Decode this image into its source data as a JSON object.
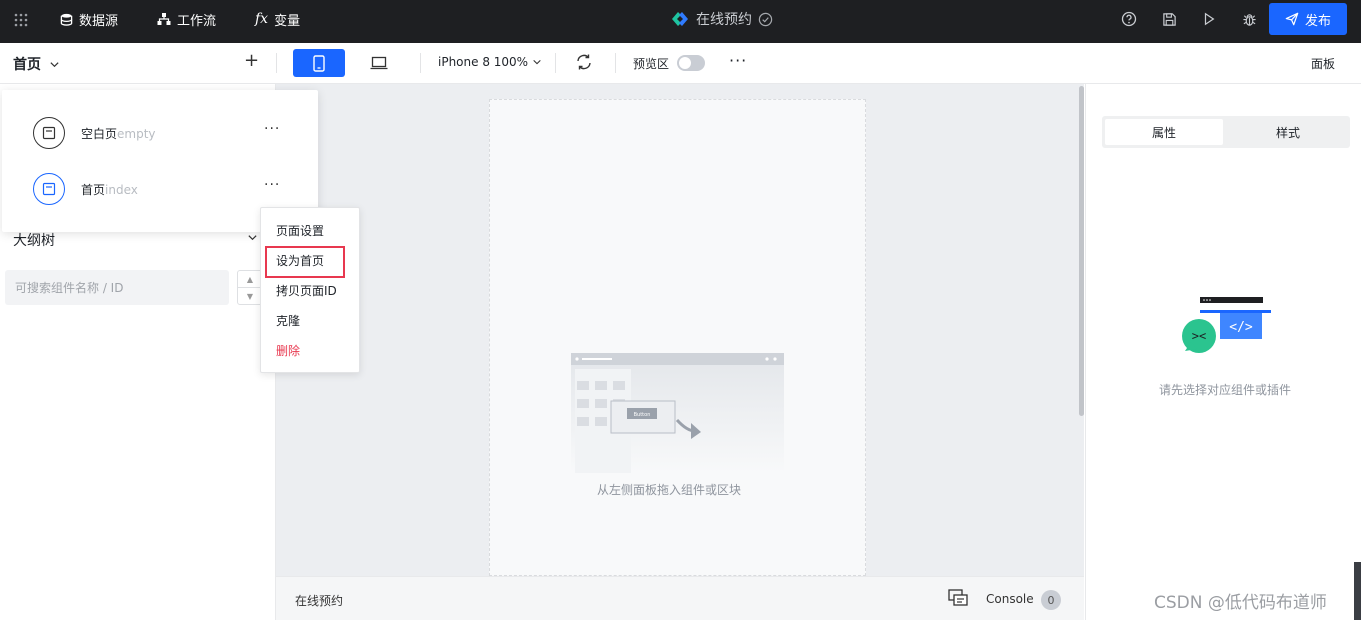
{
  "topbar": {
    "datasource_label": "数据源",
    "workflow_label": "工作流",
    "variable_label": "变量",
    "app_title": "在线预约",
    "publish_label": "发布"
  },
  "toolbar": {
    "current_page": "首页",
    "device_label": "iPhone 8 100%",
    "preview_label": "预览区",
    "panel_label": "面板"
  },
  "pages": [
    {
      "name": "空白页",
      "id": "empty"
    },
    {
      "name": "首页",
      "id": "index"
    }
  ],
  "context_menu": {
    "items": [
      "页面设置",
      "设为首页",
      "拷贝页面ID",
      "克隆",
      "删除"
    ]
  },
  "left_panel": {
    "outline_title": "大纲树",
    "search_placeholder": "可搜索组件名称 / ID"
  },
  "canvas": {
    "empty_hint": "从左侧面板拖入组件或区块",
    "button_text": "Button"
  },
  "bottombar": {
    "title": "在线预约",
    "console_label": "Console",
    "console_count": "0"
  },
  "right_panel": {
    "tabs": [
      "属性",
      "样式"
    ],
    "empty_hint": "请先选择对应组件或插件"
  },
  "watermark": "CSDN @低代码布道师",
  "colors": {
    "accent": "#1a66ff",
    "topbar_bg": "#1e1f22",
    "danger": "#e8384f"
  }
}
